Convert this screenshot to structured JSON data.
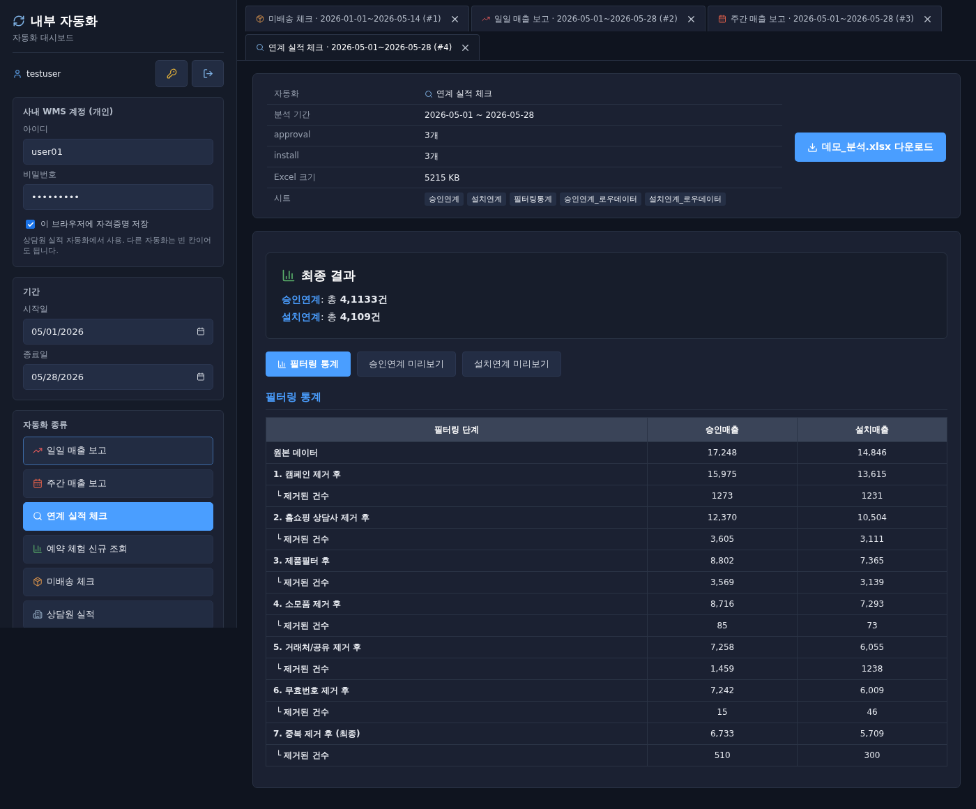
{
  "sidebar": {
    "title": "내부 자동화",
    "subtitle": "자동화 대시보드",
    "user": "testuser",
    "account": {
      "title": "사내 WMS 계정 (개인)",
      "id_label": "아이디",
      "id_value": "user01",
      "pw_label": "비밀번호",
      "pw_value": "•••••••••",
      "remember_label": "이 브라우저에 자격증명 저장",
      "remember_checked": true,
      "note": "상담원 실적 자동화에서 사용. 다른 자동화는 빈 칸이어도 됩니다."
    },
    "period": {
      "title": "기간",
      "start_label": "시작일",
      "start_value": "05/01/2026",
      "end_label": "종료일",
      "end_value": "05/28/2026"
    },
    "automation": {
      "title": "자동화 종류",
      "items": [
        {
          "kind": "trend",
          "label": "일일 매출 보고",
          "selected": false,
          "focused": true
        },
        {
          "kind": "calendar",
          "label": "주간 매출 보고",
          "selected": false,
          "focused": false
        },
        {
          "kind": "search",
          "label": "연계 실적 체크",
          "selected": true,
          "focused": false
        },
        {
          "kind": "bars",
          "label": "예약 체험 신규 조회",
          "selected": false,
          "focused": false
        },
        {
          "kind": "box",
          "label": "미배송 체크",
          "selected": false,
          "focused": false
        },
        {
          "kind": "building",
          "label": "상담원 실적",
          "selected": false,
          "focused": false
        }
      ]
    }
  },
  "tabs": [
    {
      "kind": "box",
      "label": "미배송 체크 · 2026-01-01~2026-05-14 (#1)",
      "selected": false
    },
    {
      "kind": "trend",
      "label": "일일 매출 보고 · 2026-05-01~2026-05-28 (#2)",
      "selected": false
    },
    {
      "kind": "calendar",
      "label": "주간 매출 보고 · 2026-05-01~2026-05-28 (#3)",
      "selected": false
    },
    {
      "kind": "search",
      "label": "연계 실적 체크 · 2026-05-01~2026-05-28 (#4)",
      "selected": true
    }
  ],
  "summary": {
    "rows": [
      {
        "key": "자동화",
        "value": "연계 실적 체크"
      },
      {
        "key": "분석 기간",
        "value": "2026-05-01 ~ 2026-05-28"
      },
      {
        "key": "approval",
        "value": "3개"
      },
      {
        "key": "install",
        "value": "3개"
      },
      {
        "key": "Excel 크기",
        "value": "5215 KB"
      }
    ],
    "sheets_label": "시트",
    "sheets": [
      "승인연계",
      "설치연계",
      "필터링통계",
      "승인연계_로우데이터",
      "설치연계_로우데이터"
    ],
    "download_button": "데모_분석.xlsx 다운로드"
  },
  "result": {
    "title": "최종 결과",
    "lines": [
      {
        "label": "승인연계",
        "text": ": 총 **4,1133건**"
      },
      {
        "label": "설치연계",
        "text": ": 총 **4,109건**"
      }
    ]
  },
  "view_tabs": [
    {
      "label": "필터링 통계",
      "selected": true
    },
    {
      "label": "승인연계 미리보기",
      "selected": false
    },
    {
      "label": "설치연계 미리보기",
      "selected": false
    }
  ],
  "section_title": "필터링 통계",
  "table": {
    "columns": [
      "필터링 단계",
      "승인매출",
      "설치매출"
    ],
    "rows": [
      {
        "kind": "step",
        "cells": [
          "원본 데이터",
          "17,248",
          "14,846"
        ]
      },
      {
        "kind": "step",
        "cells": [
          "1. 캠페인 제거 후",
          "15,975",
          "13,615"
        ]
      },
      {
        "kind": "sub",
        "cells": [
          "└ 제거된 건수",
          "1273",
          "1231"
        ]
      },
      {
        "kind": "step",
        "cells": [
          "2. 홈쇼핑 상담사 제거 후",
          "12,370",
          "10,504"
        ]
      },
      {
        "kind": "sub",
        "cells": [
          "└ 제거된 건수",
          "3,605",
          "3,111"
        ]
      },
      {
        "kind": "step",
        "cells": [
          "3. 제품필터 후",
          "8,802",
          "7,365"
        ]
      },
      {
        "kind": "sub",
        "cells": [
          "└ 제거된 건수",
          "3,569",
          "3,139"
        ]
      },
      {
        "kind": "step",
        "cells": [
          "4. 소모품 제거 후",
          "8,716",
          "7,293"
        ]
      },
      {
        "kind": "sub",
        "cells": [
          "└ 제거된 건수",
          "85",
          "73"
        ]
      },
      {
        "kind": "step",
        "cells": [
          "5. 거래처/공유 제거 후",
          "7,258",
          "6,055"
        ]
      },
      {
        "kind": "sub",
        "cells": [
          "└ 제거된 건수",
          "1,459",
          "1238"
        ]
      },
      {
        "kind": "step",
        "cells": [
          "6. 무효번호 제거 후",
          "7,242",
          "6,009"
        ]
      },
      {
        "kind": "sub",
        "cells": [
          "└ 제거된 건수",
          "15",
          "46"
        ]
      },
      {
        "kind": "step",
        "cells": [
          "7. 중복 제거 후 (최종)",
          "6,733",
          "5,709"
        ]
      },
      {
        "kind": "sub",
        "cells": [
          "└ 제거된 건수",
          "510",
          "300"
        ]
      }
    ]
  }
}
